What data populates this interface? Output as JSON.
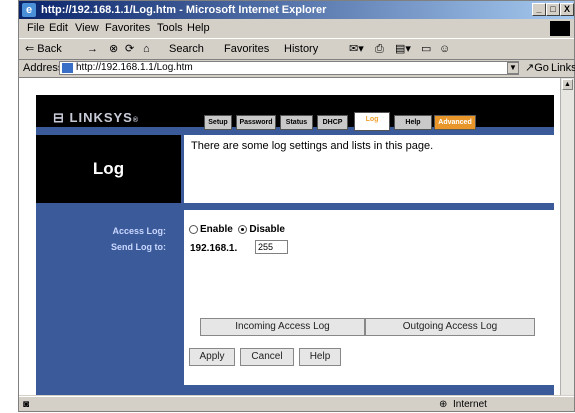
{
  "window": {
    "title": "http://192.168.1.1/Log.htm - Microsoft Internet Explorer",
    "controls": [
      "_",
      "□",
      "X"
    ]
  },
  "menu": {
    "items": [
      "File",
      "Edit",
      "View",
      "Favorites",
      "Tools",
      "Help"
    ]
  },
  "toolbar": {
    "back": "⇐ Back",
    "forward": "→",
    "search": "Search",
    "favorites": "Favorites",
    "history": "History"
  },
  "address": {
    "label": "Address",
    "url": "http://192.168.1.1/Log.htm",
    "go": "Go",
    "links": "Links"
  },
  "page": {
    "brand": "LINKSYS",
    "tabs": [
      "Setup",
      "Password",
      "Status",
      "DHCP",
      "Log",
      "Help",
      "Advanced"
    ],
    "active_tab": "Log",
    "title": "Log",
    "info": "There are some log settings and lists in this page.",
    "access_log_label": "Access Log:",
    "send_log_label": "Send Log to:",
    "enable_label": "Enable",
    "disable_label": "Disable",
    "selected": "Disable",
    "ip_prefix": "192.168.1.",
    "ip_last": "255",
    "incoming_button": "Incoming Access Log",
    "outgoing_button": "Outgoing Access Log",
    "apply_button": "Apply",
    "cancel_button": "Cancel",
    "help_button": "Help"
  },
  "status": {
    "zone": "Internet"
  }
}
